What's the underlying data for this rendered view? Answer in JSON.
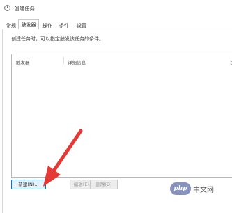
{
  "window": {
    "title": "创建任务",
    "icon": "task-scheduler-icon"
  },
  "tabs": [
    {
      "label": "常规",
      "active": false
    },
    {
      "label": "触发器",
      "active": true
    },
    {
      "label": "操作",
      "active": false
    },
    {
      "label": "条件",
      "active": false
    },
    {
      "label": "设置",
      "active": false
    }
  ],
  "triggers_tab": {
    "description": "创建任务时，可以指定触发该任务的条件。",
    "columns": [
      "触发器",
      "详细信息",
      "状"
    ],
    "rows": []
  },
  "buttons": {
    "new_label": "新建(N)...",
    "edit_label": "编辑(E)...",
    "delete_label": "删除(D)"
  },
  "annotation": {
    "arrow_color": "#e53935",
    "points_to": "new-trigger-button"
  },
  "watermark": {
    "badge": "php",
    "text": "中文网",
    "color": "#8892bf"
  }
}
